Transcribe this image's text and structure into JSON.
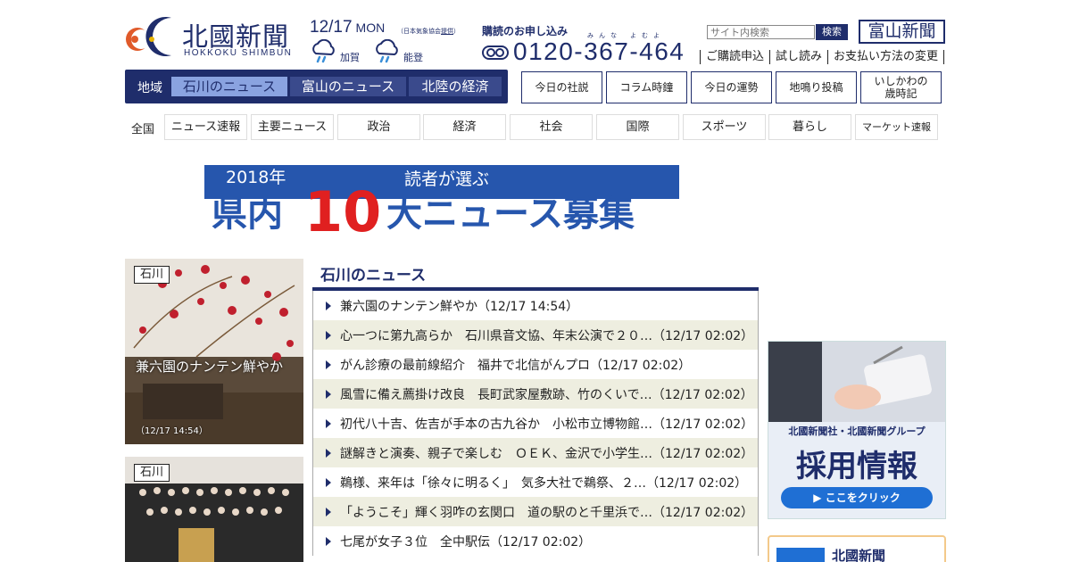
{
  "header": {
    "logo_title": "北國新聞",
    "logo_sub": "HOKKOKU SHIMBUN",
    "date": "12/17",
    "weekday": "MON",
    "weather_note_prefix": "（日本気象協会",
    "weather_note_link": "提供",
    "weather_note_suffix": "）",
    "weather": [
      {
        "area": "加賀",
        "icon": "rain-cloud-icon"
      },
      {
        "area": "能登",
        "icon": "rain-cloud-icon"
      }
    ],
    "subscribe_label": "購読のお申し込み",
    "phone_ruby_1": "みんな",
    "phone_ruby_2": "よむよ",
    "phone": "0120-367-464",
    "search_placeholder": "サイト内検索",
    "search_button": "検索",
    "toyama_logo": "富山新聞",
    "top_links": [
      "ご購読申込",
      "試し読み",
      "お支払い方法の変更"
    ]
  },
  "region_nav": {
    "label": "地域",
    "tabs": [
      "石川のニュース",
      "富山のニュース",
      "北陸の経済"
    ],
    "active_index": 0
  },
  "feature_buttons": [
    "今日の社説",
    "コラム時鐘",
    "今日の運勢",
    "地鳴り投稿",
    "いしかわの",
    "歳時記"
  ],
  "category_nav": {
    "label": "全国",
    "items": [
      "ニュース速報",
      "主要ニュース",
      "政治",
      "経済",
      "社会",
      "国際",
      "スポーツ",
      "暮らし",
      "マーケット速報"
    ]
  },
  "banner": {
    "year": "2018年",
    "sub": "読者が選ぶ",
    "pre": "県内",
    "num": "10",
    "post": "大ニュース募集"
  },
  "cards": [
    {
      "tag": "石川",
      "caption": "兼六園のナンテン鮮やか",
      "time": "（12/17 14:54）"
    },
    {
      "tag": "石川",
      "caption": "",
      "time": ""
    }
  ],
  "news": {
    "title": "石川のニュース",
    "items": [
      "兼六園のナンテン鮮やか（12/17 14:54）",
      "心一つに第九高らか　石川県音文協、年末公演で２０…（12/17 02:02）",
      "がん診療の最前線紹介　福井で北信がんプロ（12/17 02:02）",
      "風雪に備え薦掛け改良　長町武家屋敷跡、竹のくいで…（12/17 02:02）",
      "初代八十吉、佐吉が手本の古九谷か　小松市立博物館…（12/17 02:02）",
      "謎解きと演奏、親子で楽しむ　ＯＥＫ、金沢で小学生…（12/17 02:02）",
      "鵜様、来年は「徐々に明るく」　気多大社で鵜祭、２…（12/17 02:02）",
      "「ようこそ」輝く羽咋の玄関口　道の駅のと千里浜で…（12/17 02:02）",
      "七尾が女子３位　全中駅伝（12/17 02:02）"
    ]
  },
  "recruit_ad": {
    "line1": "北國新聞社・北國新聞グループ",
    "line2": "採用情報",
    "button": "▶ ここをクリック"
  },
  "promo": {
    "title": "北國新聞"
  },
  "colors": {
    "brand_navy": "#1f2d6b",
    "active_tab": "#8aa3e0",
    "alt_row": "#eeeee0",
    "banner_blue": "#2656ad",
    "banner_red": "#e02020"
  }
}
